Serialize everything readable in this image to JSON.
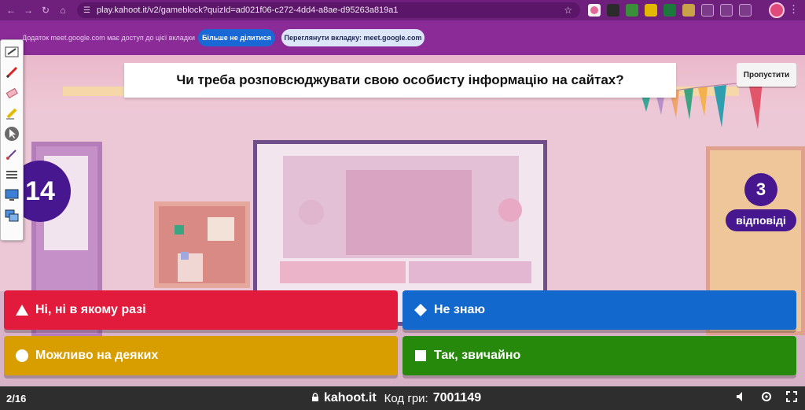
{
  "browser": {
    "url": "play.kahoot.it/v2/gameblock?quizId=ad021f06-c272-4dd4-a8ae-d95263a819a1"
  },
  "share_bar": {
    "message": "Додаток meet.google.com має доступ до цієї вкладки",
    "stop_sharing": "Більше не ділитися",
    "view_tab": "Переглянути вкладку: meet.google.com"
  },
  "question": {
    "text": "Чи треба розповсюджувати свою особисту інформацію на сайтах?",
    "skip_label": "Пропустити"
  },
  "timer": "14",
  "answers_count": "3",
  "answers_label": "відповіді",
  "answers": [
    {
      "text": "Ні, ні в якому разі",
      "color": "#e21b3c",
      "shape": "triangle"
    },
    {
      "text": "Не знаю",
      "color": "#1368ce",
      "shape": "diamond"
    },
    {
      "text": "Можливо на деяких",
      "color": "#d89e00",
      "shape": "circle"
    },
    {
      "text": "Так, звичайно",
      "color": "#26890c",
      "shape": "square"
    }
  ],
  "footer": {
    "progress": "2/16",
    "domain": "kahoot.it",
    "code_label": "Код гри:",
    "code_value": "7001149"
  }
}
